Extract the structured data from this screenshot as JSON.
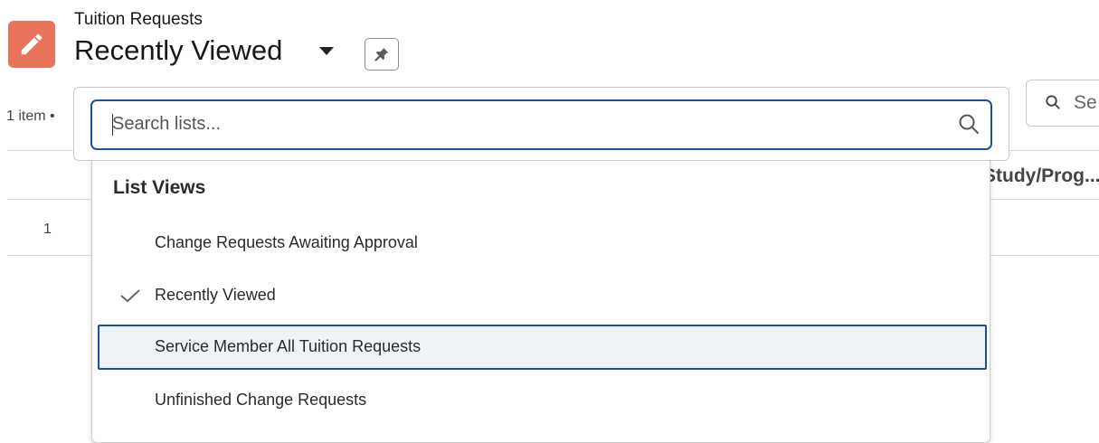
{
  "header": {
    "object_name": "Tuition Requests",
    "list_view_title": "Recently Viewed",
    "app_icon": "pencil-icon",
    "pin_icon": "pin-icon"
  },
  "list_info": {
    "item_count": "1 item •"
  },
  "table_search": {
    "placeholder": "Se"
  },
  "table": {
    "columns": [
      "Study/Prog..."
    ],
    "rows": [
      {
        "number": "1"
      }
    ]
  },
  "list_search": {
    "placeholder": "Search lists...",
    "value": ""
  },
  "dropdown": {
    "heading": "List Views",
    "items": [
      {
        "label": "Change Requests Awaiting Approval",
        "selected": false,
        "focused": false
      },
      {
        "label": "Recently Viewed",
        "selected": true,
        "focused": false
      },
      {
        "label": "Service Member All Tuition Requests",
        "selected": false,
        "focused": true
      },
      {
        "label": "Unfinished Change Requests",
        "selected": false,
        "focused": false
      }
    ]
  },
  "colors": {
    "brand_icon": "#e8745c",
    "focus_border": "#1b5297",
    "focused_row_bg": "#eef3f7"
  }
}
